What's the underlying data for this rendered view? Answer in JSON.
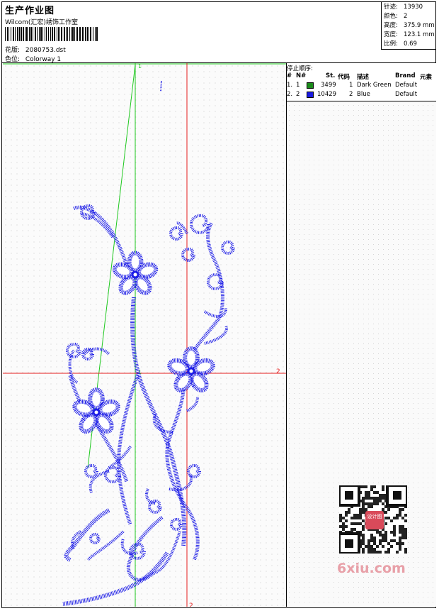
{
  "header": {
    "title": "生产作业图",
    "company": "Wilcom(汇宏)绣饰工作室",
    "design_label": "花版:",
    "design_value": "2080753.dst",
    "colorway_label": "色位:",
    "colorway_value": "Colorway 1"
  },
  "stats": {
    "stitches_label": "针迹:",
    "stitches_value": "13930",
    "colors_label": "颜色:",
    "colors_value": "2",
    "height_label": "高度:",
    "height_value": "375.9 mm",
    "width_label": "宽度:",
    "width_value": "123.1 mm",
    "scale_label": "比例:",
    "scale_value": "0.69"
  },
  "canvas": {
    "marker_top_1": "1",
    "marker_mid_1": "1",
    "marker_right_2": "2",
    "marker_bottom_2": "2",
    "colors": {
      "thread": "#1e1ee6",
      "green_guide": "#1ec81e",
      "red_guide": "#e61e1e"
    }
  },
  "stoplist": {
    "title": "停止顺序:",
    "columns": [
      "#",
      "N#",
      "St.",
      "代码",
      "描述",
      "Brand",
      "元素"
    ],
    "rows": [
      {
        "idx": "1.",
        "n": "1",
        "color": "#1a8a1a",
        "st": "3499",
        "code": "1",
        "desc": "Dark Green",
        "brand": "Default"
      },
      {
        "idx": "2.",
        "n": "2",
        "color": "#1a1ae0",
        "st": "10429",
        "code": "2",
        "desc": "Blue",
        "brand": "Default"
      }
    ]
  },
  "watermark": {
    "text": "6xiu.com",
    "stamp": "设计图"
  }
}
